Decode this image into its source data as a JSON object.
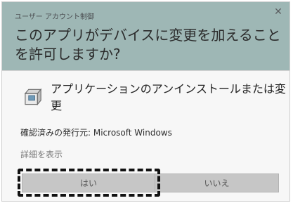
{
  "dialog": {
    "small_title": "ユーザー アカウント制御",
    "close_glyph": "✕",
    "question": "このアプリがデバイスに変更を加えることを許可しますか?",
    "app_name": "アプリケーションのアンインストールまたは変更",
    "publisher": "確認済みの発行元: Microsoft Windows",
    "details_link": "詳細を表示",
    "yes_label": "はい",
    "no_label": "いいえ",
    "app_icon": "uninstall-box-icon"
  },
  "colors": {
    "header": "#9eb7b5",
    "body": "#f7f7f7",
    "button": "#c6c6c6",
    "focus_ring": "#111111"
  }
}
